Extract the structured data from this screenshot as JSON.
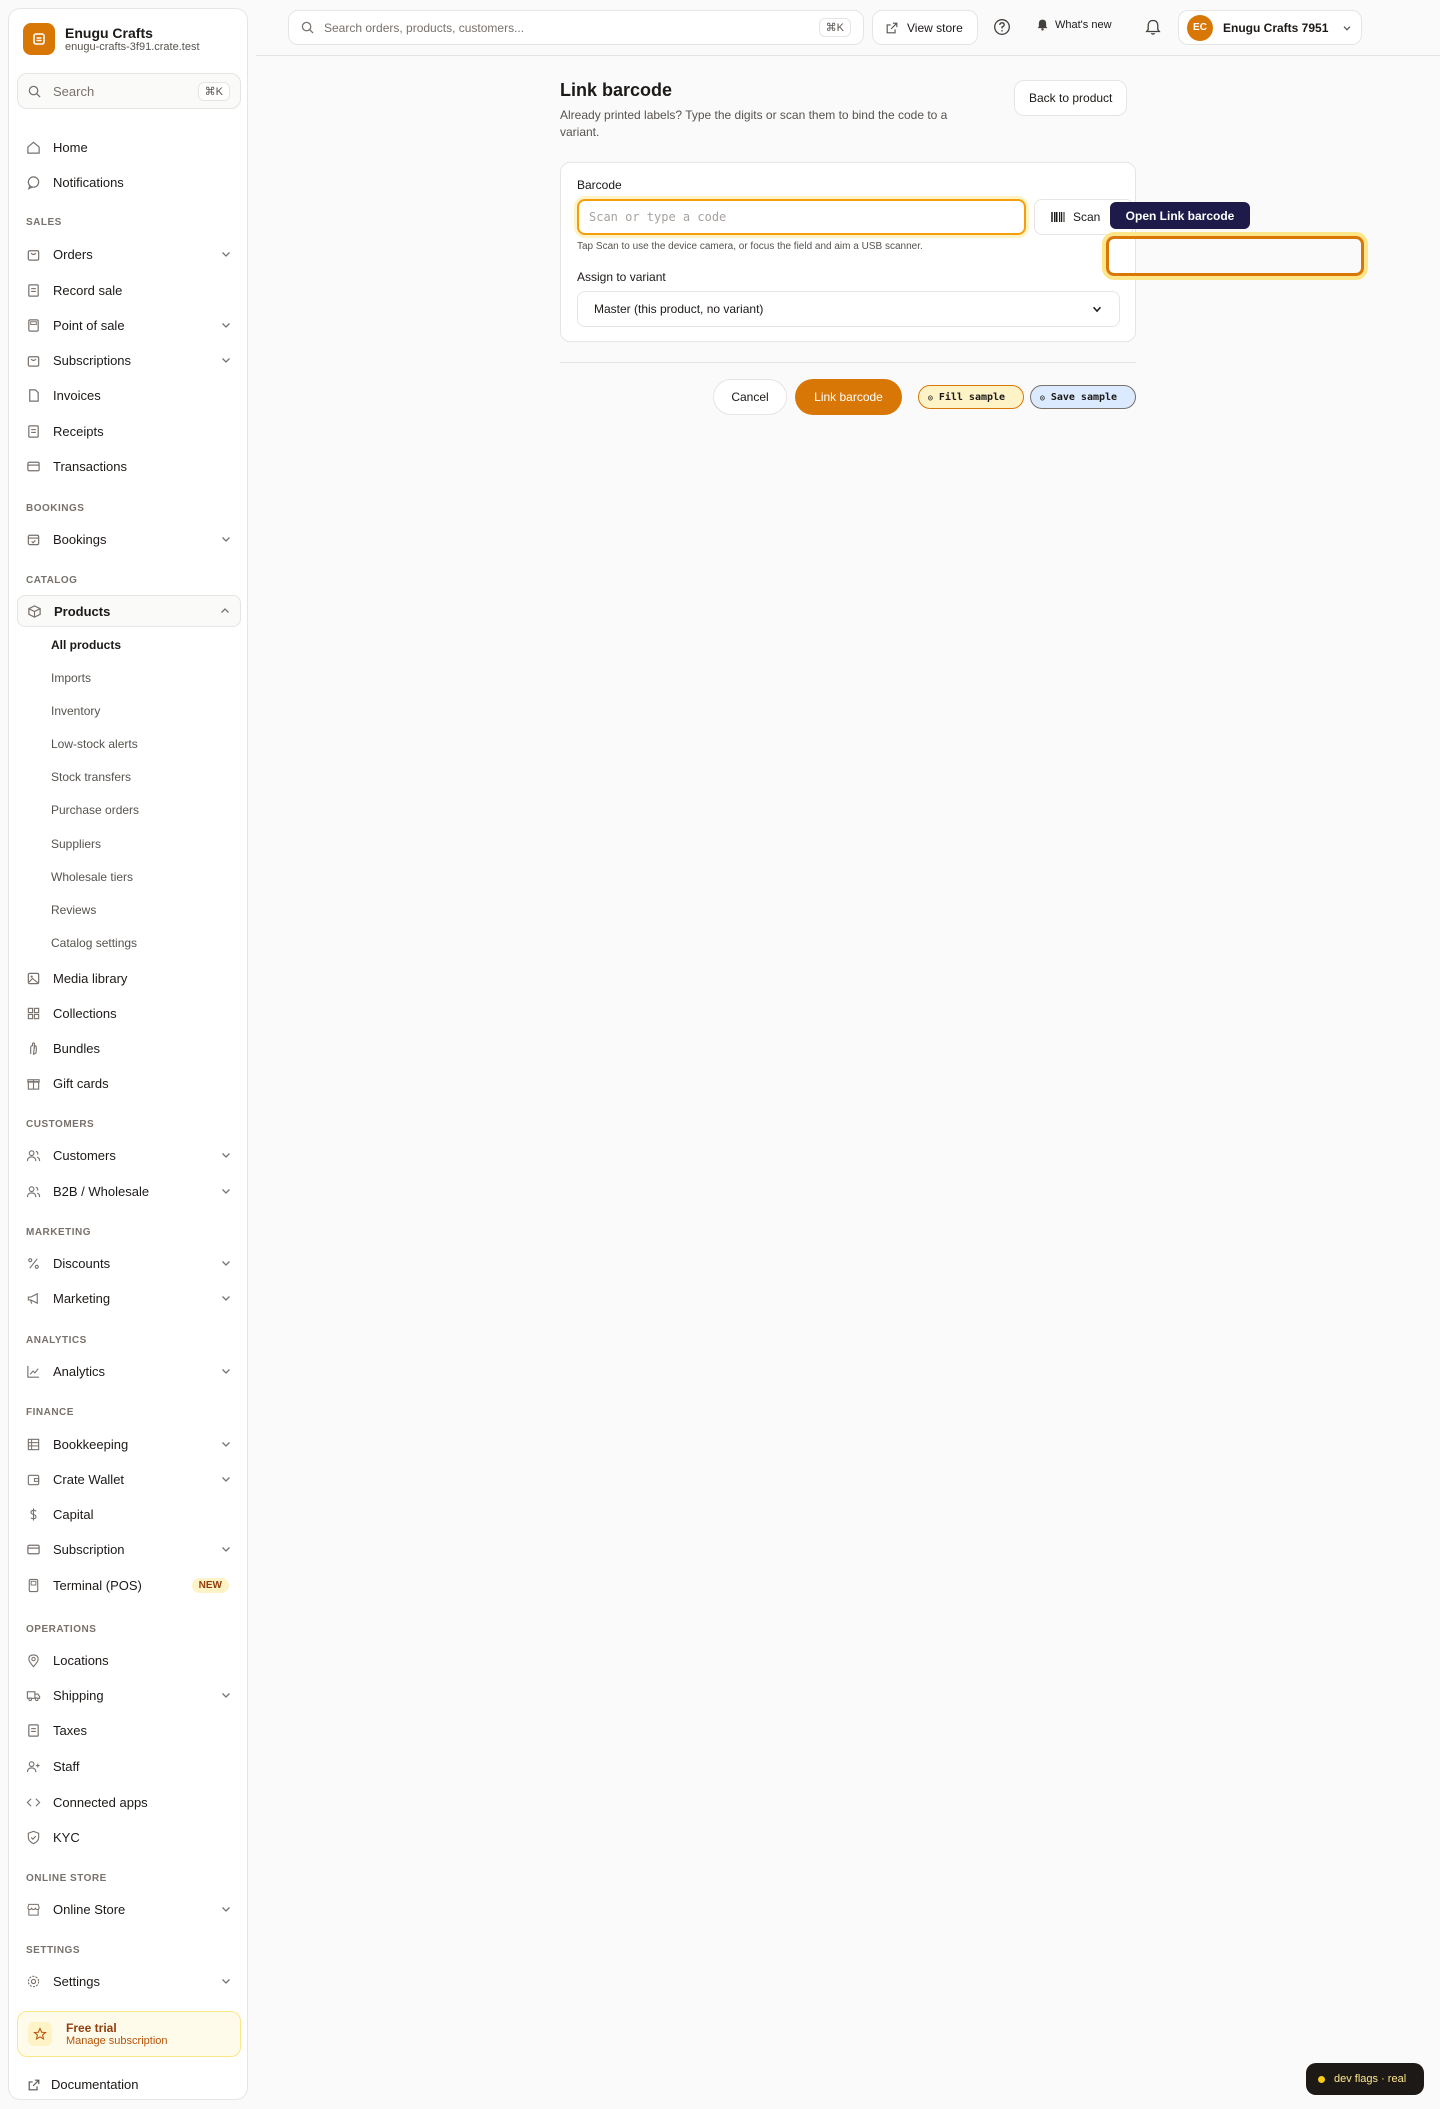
{
  "brand": {
    "name": "Enugu Crafts",
    "domain": "enugu-crafts-3f91.crate.test"
  },
  "sidebar": {
    "search_label": "Search",
    "search_shortcut": "⌘K",
    "items": {
      "home": "Home",
      "notifications": "Notifications",
      "orders": "Orders",
      "record_sale": "Record sale",
      "point_of_sale": "Point of sale",
      "subscriptions": "Subscriptions",
      "invoices": "Invoices",
      "receipts": "Receipts",
      "transactions": "Transactions",
      "bookings": "Bookings",
      "products": "Products",
      "media_library": "Media library",
      "collections": "Collections",
      "bundles": "Bundles",
      "gift_cards": "Gift cards",
      "customers": "Customers",
      "b2b": "B2B / Wholesale",
      "discounts": "Discounts",
      "marketing": "Marketing",
      "analytics": "Analytics",
      "bookkeeping": "Bookkeeping",
      "crate_wallet": "Crate Wallet",
      "capital": "Capital",
      "subscription": "Subscription",
      "terminal": "Terminal (POS)",
      "locations": "Locations",
      "shipping": "Shipping",
      "taxes": "Taxes",
      "staff": "Staff",
      "connected_apps": "Connected apps",
      "kyc": "KYC",
      "online_store": "Online Store",
      "settings": "Settings"
    },
    "sections": {
      "sales": "SALES",
      "bookings": "BOOKINGS",
      "catalog": "CATALOG",
      "customers": "CUSTOMERS",
      "marketing": "MARKETING",
      "analytics": "ANALYTICS",
      "finance": "FINANCE",
      "operations": "OPERATIONS",
      "online_store": "ONLINE STORE",
      "settings": "SETTINGS"
    },
    "products_sub": [
      "All products",
      "Imports",
      "Inventory",
      "Low-stock alerts",
      "Stock transfers",
      "Purchase orders",
      "Suppliers",
      "Wholesale tiers",
      "Reviews",
      "Catalog settings"
    ],
    "terminal_badge": "NEW",
    "trial": {
      "title": "Free trial",
      "subtitle": "Manage subscription"
    },
    "documentation": "Documentation"
  },
  "topbar": {
    "search_placeholder": "Search orders, products, customers...",
    "search_shortcut": "⌘K",
    "view_store": "View store",
    "whats_new": "What's new",
    "account": {
      "initials": "EC",
      "name": "Enugu Crafts 7951"
    }
  },
  "main": {
    "title": "Link barcode",
    "description": "Already printed labels? Type the digits or scan them to bind the code to a variant.",
    "back_button": "Back to product",
    "barcode_label": "Barcode",
    "barcode_placeholder": "Scan or type a code",
    "scan_button": "Scan",
    "hint": "Tap Scan to use the device camera, or focus the field and aim a USB scanner.",
    "variant_label": "Assign to variant",
    "variant_value": "Master (this product, no variant)",
    "cancel": "Cancel",
    "submit": "Link barcode",
    "fill_sample": "Fill sample",
    "save_sample": "Save sample"
  },
  "tooltip": "Open Link barcode",
  "dev_flags": "dev flags · real",
  "colors": {
    "accent": "#d97706",
    "tooltip_bg": "#1e1b4b"
  }
}
